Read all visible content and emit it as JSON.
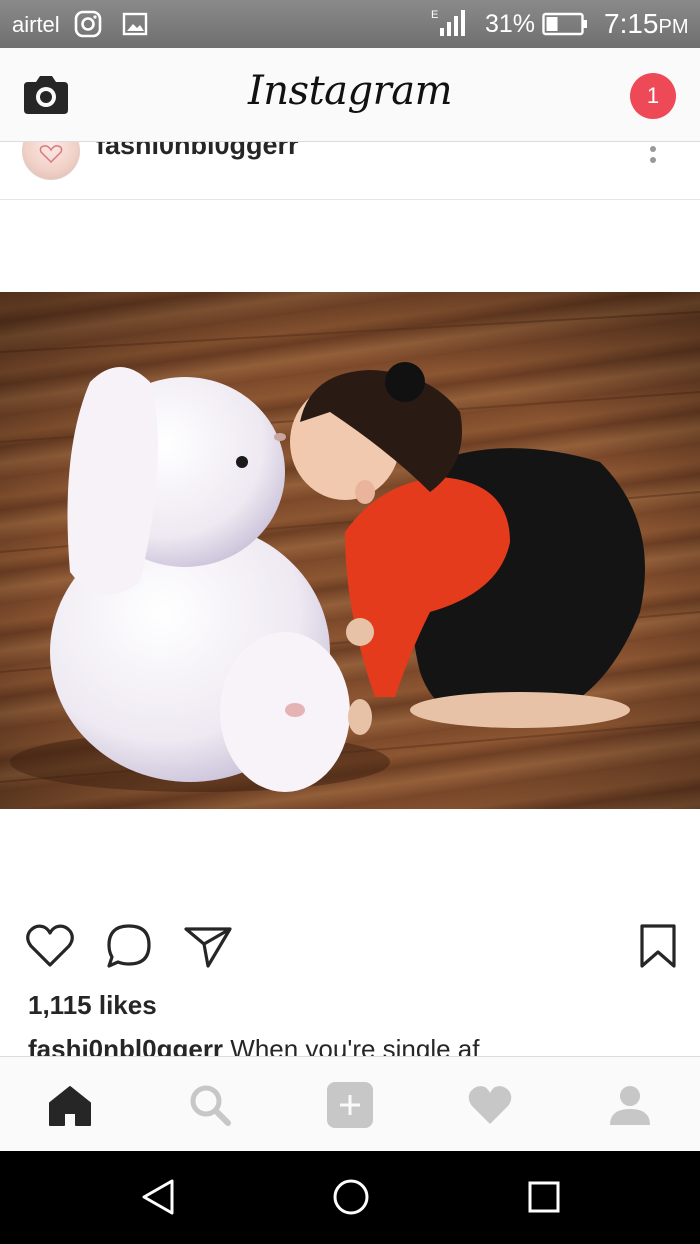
{
  "status_bar": {
    "carrier": "airtel",
    "battery_percent": "31%",
    "time": "7:15",
    "time_suffix": "PM",
    "network_type": "E"
  },
  "header": {
    "logo_text": "Instagram",
    "notification_count": "1",
    "icons": {
      "left": "camera-icon"
    }
  },
  "post": {
    "username": "fashi0nbl0ggerr",
    "likes": "1,115 likes",
    "caption_username": "fashi0nbl0ggerr",
    "caption_text": " When you're single af",
    "actions": [
      "heart-icon",
      "comment-icon",
      "share-icon",
      "bookmark-icon"
    ]
  },
  "bottom_nav": {
    "items": [
      "home-icon",
      "search-icon",
      "add-post-icon",
      "activity-icon",
      "profile-icon"
    ],
    "active": "home-icon"
  },
  "system_nav": {
    "items": [
      "back-icon",
      "home-circle-icon",
      "recents-icon"
    ]
  },
  "colors": {
    "badge": "#ed4956",
    "status_bar": "#7a7a7a",
    "nav_inactive": "#c7c7c7"
  }
}
